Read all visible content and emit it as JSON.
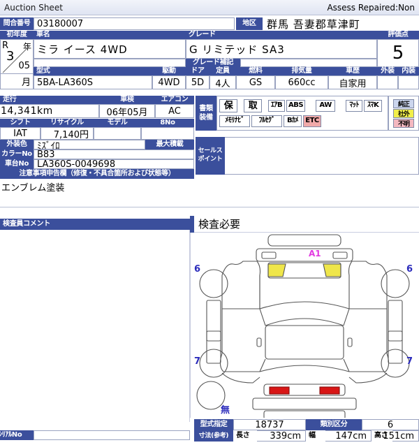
{
  "window": {
    "title": "Auction Sheet",
    "assess": "Assess Repaired:Non"
  },
  "top": {
    "inquiry_label": "問合番号",
    "inquiry_value": "03180007",
    "region_label": "地区",
    "region_value": "群馬  吾妻郡草津町"
  },
  "vehicle": {
    "first_year_label": "初年度",
    "first_year_era": "R",
    "first_year_nen": "年",
    "first_year_num": "3",
    "first_year_month_num": "05",
    "first_year_getsu": "月",
    "carname_label": "車名",
    "carname_value": "ミラ  イース  4WD",
    "grade_label": "グレード",
    "grade_value": "G  リミテッド  SA3",
    "grade_note_label": "グレード補記",
    "grade_note_value": "",
    "score_label": "評価点",
    "score_value": "5"
  },
  "spec": {
    "model_label": "型式",
    "model_value": "5BA-LA360S",
    "drive_label": "駆動",
    "drive_value": "4WD",
    "door_label": "ドア",
    "door_value": "5D",
    "seats_label": "定員",
    "seats_value": "4人",
    "fuel_label": "燃料",
    "fuel_value": "GS",
    "displacement_label": "排気量",
    "displacement_value": "660cc",
    "history_label": "車歴",
    "history_value": "自家用",
    "exterior_label": "外装",
    "exterior_value": "",
    "interior_label": "内装",
    "interior_value": ""
  },
  "run": {
    "mileage_label": "走行",
    "mileage_value": "14,341km",
    "shaken_label": "車検",
    "shaken_value": "06年05月",
    "aircon_label": "エアコン",
    "aircon_value": "AC"
  },
  "equipment": {
    "label": "書類\n装備",
    "label_line1": "書類",
    "label_line2": "装備",
    "row1": [
      "保",
      "取",
      "ｴｱB",
      "ABS",
      "AW",
      "ﾏｯﾄ",
      "ｽﾏK"
    ],
    "row2": [
      "ﾒﾓﾘﾅﾋﾞ",
      "ﾌﾙｾｸﾞ",
      "Bｶﾒ",
      "ETC"
    ],
    "etc_highlight": "ETC",
    "legend": [
      "純正",
      "社外",
      "不明"
    ],
    "legend_colors": [
      "#ccd6ee",
      "#f2ef4a",
      "#f4b8c0"
    ]
  },
  "details": {
    "shift_label": "シフト",
    "shift_value": "IAT",
    "recycle_label": "リサイクル",
    "recycle_value": "7,140円",
    "modeltype_label": "モデル",
    "modeltype_value": "",
    "eightno_label": "8No",
    "eightno_value": "",
    "color_label": "外装色",
    "color_value": "ﾐｽﾞｲﾛ",
    "colorno_label": "カラーNo",
    "colorno_value": "B83",
    "chassis_label": "車台No",
    "chassis_value": "LA360S-0049698",
    "maxload_label": "最大積載",
    "maxload_value": "",
    "salespoint_label_line1": "セールス",
    "salespoint_label_line2": "ポイント",
    "salespoint_value": ""
  },
  "notice": {
    "header": "注意事項申告欄（修復・不具合箇所および状態等）",
    "text": "エンブレム塗装"
  },
  "comment": {
    "header": "検査員コメント",
    "text": ""
  },
  "inspection": {
    "header": "検査必要"
  },
  "diagram": {
    "front_mark": "A1",
    "left_front_num": "6",
    "right_front_num": "6",
    "left_rear_num": "7",
    "right_rear_num": "7",
    "spare_mark": "無"
  },
  "bottom": {
    "type_desig_label": "型式指定",
    "type_desig_value": "18737",
    "category_label": "類別区分",
    "category_value": "6",
    "dims_label": "寸法(参考)",
    "length_label": "長さ",
    "length_value": "339cm",
    "width_label": "幅",
    "width_value": "147cm",
    "height_label": "高さ",
    "height_value": "151cm",
    "serial_label": "ｼﾘｱﾙNo",
    "serial_value": ""
  }
}
